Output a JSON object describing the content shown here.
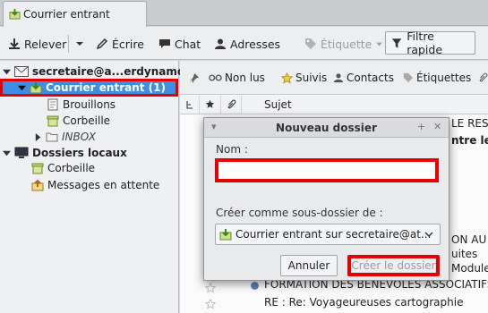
{
  "tab": {
    "title": "Courrier entrant"
  },
  "toolbar": {
    "get_mail": "Relever",
    "write": "Écrire",
    "chat": "Chat",
    "address_book": "Adresses",
    "tag": "Étiquette",
    "quick_filter": "Filtre rapide"
  },
  "folders": {
    "account": "secretaire@a...erdynamo.fr",
    "inbox": "Courrier entrant (1)",
    "drafts": "Brouillons",
    "trash": "Corbeille",
    "inbox_sub": "INBOX",
    "local_folders": "Dossiers locaux",
    "local_trash": "Corbeille",
    "outbox": "Messages en attente"
  },
  "quickfilter": {
    "unread": "Non lus",
    "starred": "Suivis",
    "contacts": "Contacts",
    "tags": "Étiquettes"
  },
  "columns": {
    "subject": "Sujet"
  },
  "messages": {
    "m1": "LE RES",
    "m2": "ntre le",
    "m3": "ON AU",
    "m4": "uites",
    "m5": "Module",
    "m6": "FORMATION DES BENEVOLES ASSOCIATIFS-",
    "m7": "RE : Re: Voyageureuses cartographie"
  },
  "dialog": {
    "title": "Nouveau dossier",
    "name_label": "Nom :",
    "name_value": "",
    "parent_label": "Créer comme sous-dossier de :",
    "parent_value": "Courrier entrant sur secretaire@at...",
    "cancel": "Annuler",
    "create": "Créer le dossier"
  },
  "colors": {
    "selection": "#3b90e4",
    "highlight": "#e80000"
  }
}
